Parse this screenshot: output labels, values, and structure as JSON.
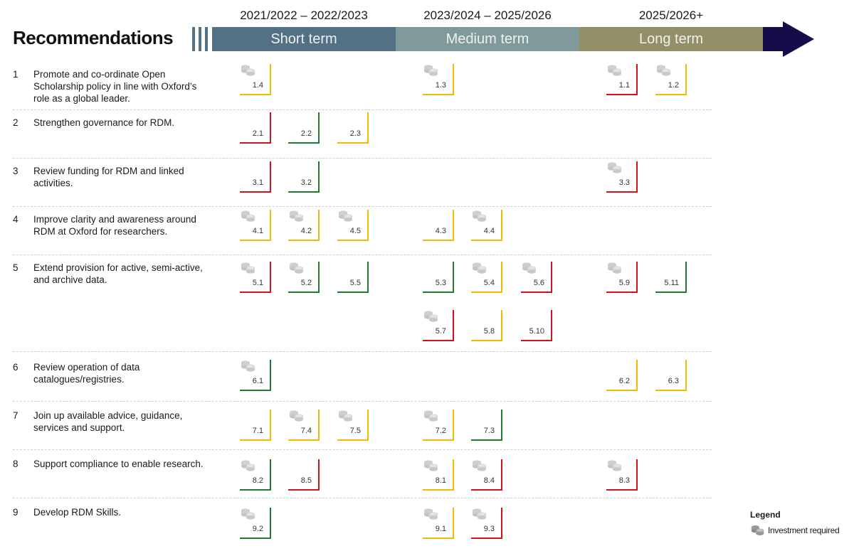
{
  "title": "Recommendations",
  "timeline": {
    "periods": [
      {
        "key": "short",
        "years": "2021/2022 – 2022/2023",
        "label": "Short term",
        "color": "#537184"
      },
      {
        "key": "medium",
        "years": "2023/2024 – 2025/2026",
        "label": "Medium term",
        "color": "#80999a"
      },
      {
        "key": "long",
        "years": "2025/2026+",
        "label": "Long term",
        "color": "#938f66"
      }
    ],
    "arrow_color": "#150d4a"
  },
  "status_colors": {
    "red": "#d0121b",
    "amber": "#f5b800",
    "green": "#1e7b2e"
  },
  "recommendations": [
    {
      "num": "1",
      "text": "Promote and co-ordinate Open Scholarship policy in line with Oxford’s role as a global leader."
    },
    {
      "num": "2",
      "text": "Strengthen governance for RDM."
    },
    {
      "num": "3",
      "text": "Review funding for RDM and linked activities."
    },
    {
      "num": "4",
      "text": "Improve clarity and awareness around RDM at Oxford for researchers."
    },
    {
      "num": "5",
      "text": "Extend provision for active, semi-active, and archive data."
    },
    {
      "num": "6",
      "text": "Review operation of data catalogues/registries."
    },
    {
      "num": "7",
      "text": "Join up available advice, guidance, services and support."
    },
    {
      "num": "8",
      "text": "Support compliance to enable research."
    },
    {
      "num": "9",
      "text": "Develop RDM Skills."
    }
  ],
  "actions": [
    {
      "id": "1.4",
      "rec": "1",
      "term": "short",
      "status": "amber",
      "investment": true
    },
    {
      "id": "1.3",
      "rec": "1",
      "term": "medium",
      "status": "amber",
      "investment": true
    },
    {
      "id": "1.1",
      "rec": "1",
      "term": "long",
      "status": "red",
      "investment": true
    },
    {
      "id": "1.2",
      "rec": "1",
      "term": "long",
      "status": "amber",
      "investment": true
    },
    {
      "id": "2.1",
      "rec": "2",
      "term": "short",
      "status": "red",
      "investment": false
    },
    {
      "id": "2.2",
      "rec": "2",
      "term": "short",
      "status": "green",
      "investment": false
    },
    {
      "id": "2.3",
      "rec": "2",
      "term": "short",
      "status": "amber",
      "investment": false
    },
    {
      "id": "3.1",
      "rec": "3",
      "term": "short",
      "status": "red",
      "investment": false
    },
    {
      "id": "3.2",
      "rec": "3",
      "term": "short",
      "status": "green",
      "investment": false
    },
    {
      "id": "3.3",
      "rec": "3",
      "term": "long",
      "status": "red",
      "investment": true
    },
    {
      "id": "4.1",
      "rec": "4",
      "term": "short",
      "status": "amber",
      "investment": true
    },
    {
      "id": "4.2",
      "rec": "4",
      "term": "short",
      "status": "amber",
      "investment": true
    },
    {
      "id": "4.5",
      "rec": "4",
      "term": "short",
      "status": "amber",
      "investment": true
    },
    {
      "id": "4.3",
      "rec": "4",
      "term": "medium",
      "status": "amber",
      "investment": false
    },
    {
      "id": "4.4",
      "rec": "4",
      "term": "medium",
      "status": "amber",
      "investment": true
    },
    {
      "id": "5.1",
      "rec": "5",
      "term": "short",
      "status": "red",
      "investment": true
    },
    {
      "id": "5.2",
      "rec": "5",
      "term": "short",
      "status": "green",
      "investment": true
    },
    {
      "id": "5.5",
      "rec": "5",
      "term": "short",
      "status": "green",
      "investment": false
    },
    {
      "id": "5.3",
      "rec": "5",
      "term": "medium",
      "status": "green",
      "investment": false
    },
    {
      "id": "5.4",
      "rec": "5",
      "term": "medium",
      "status": "amber",
      "investment": true
    },
    {
      "id": "5.6",
      "rec": "5",
      "term": "medium",
      "status": "red",
      "investment": true
    },
    {
      "id": "5.9",
      "rec": "5",
      "term": "long",
      "status": "red",
      "investment": true
    },
    {
      "id": "5.11",
      "rec": "5",
      "term": "long",
      "status": "green",
      "investment": false
    },
    {
      "id": "5.7",
      "rec": "5",
      "term": "medium",
      "status": "red",
      "investment": true
    },
    {
      "id": "5.8",
      "rec": "5",
      "term": "medium",
      "status": "amber",
      "investment": false
    },
    {
      "id": "5.10",
      "rec": "5",
      "term": "medium",
      "status": "red",
      "investment": false
    },
    {
      "id": "6.1",
      "rec": "6",
      "term": "short",
      "status": "green",
      "investment": true
    },
    {
      "id": "6.2",
      "rec": "6",
      "term": "long",
      "status": "amber",
      "investment": false
    },
    {
      "id": "6.3",
      "rec": "6",
      "term": "long",
      "status": "amber",
      "investment": false
    },
    {
      "id": "7.1",
      "rec": "7",
      "term": "short",
      "status": "amber",
      "investment": false
    },
    {
      "id": "7.4",
      "rec": "7",
      "term": "short",
      "status": "amber",
      "investment": true
    },
    {
      "id": "7.5",
      "rec": "7",
      "term": "short",
      "status": "amber",
      "investment": true
    },
    {
      "id": "7.2",
      "rec": "7",
      "term": "medium",
      "status": "amber",
      "investment": true
    },
    {
      "id": "7.3",
      "rec": "7",
      "term": "medium",
      "status": "green",
      "investment": false
    },
    {
      "id": "8.2",
      "rec": "8",
      "term": "short",
      "status": "green",
      "investment": true
    },
    {
      "id": "8.5",
      "rec": "8",
      "term": "short",
      "status": "red",
      "investment": false
    },
    {
      "id": "8.1",
      "rec": "8",
      "term": "medium",
      "status": "amber",
      "investment": true
    },
    {
      "id": "8.4",
      "rec": "8",
      "term": "medium",
      "status": "red",
      "investment": true
    },
    {
      "id": "8.3",
      "rec": "8",
      "term": "long",
      "status": "red",
      "investment": true
    },
    {
      "id": "9.2",
      "rec": "9",
      "term": "short",
      "status": "green",
      "investment": true
    },
    {
      "id": "9.1",
      "rec": "9",
      "term": "medium",
      "status": "amber",
      "investment": true
    },
    {
      "id": "9.3",
      "rec": "9",
      "term": "medium",
      "status": "red",
      "investment": true
    }
  ],
  "legend": {
    "title": "Legend",
    "items": [
      {
        "icon": "coins-icon",
        "label": "Investment required"
      }
    ]
  }
}
